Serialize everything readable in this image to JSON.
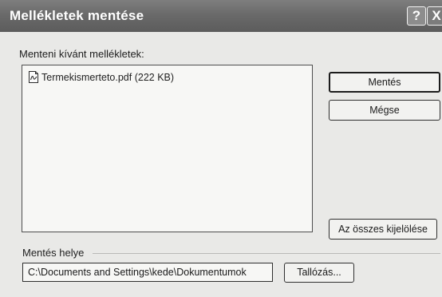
{
  "window": {
    "title": "Mellékletek mentése",
    "help_glyph": "?",
    "close_glyph": "X"
  },
  "attachments": {
    "label": "Menteni kívánt mellékletek:",
    "items": [
      {
        "name": "Termekismerteto.pdf (222 KB)",
        "icon": "pdf-file-icon"
      }
    ]
  },
  "buttons": {
    "save": "Mentés",
    "cancel": "Mégse",
    "select_all": "Az összes kijelölése",
    "browse": "Tallózás..."
  },
  "save_location": {
    "label": "Mentés helye",
    "path": "C:\\Documents and Settings\\kede\\Dokumentumok"
  }
}
